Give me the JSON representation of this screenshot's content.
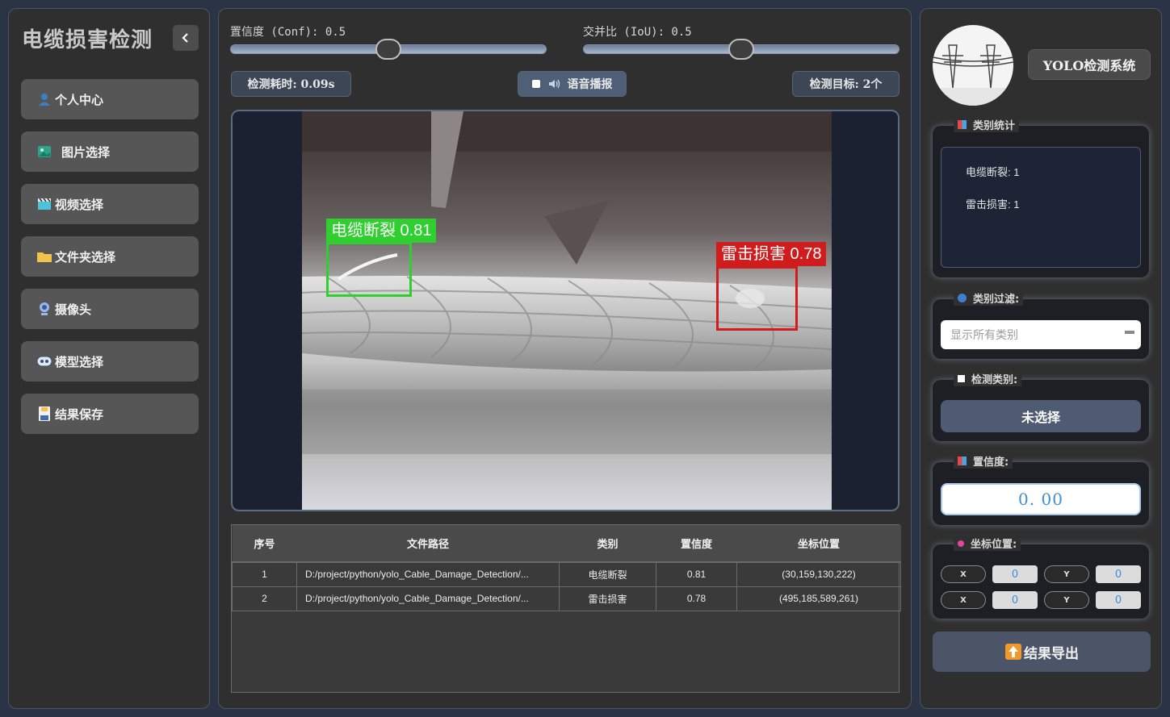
{
  "sidebar": {
    "title": "电缆损害检测",
    "items": [
      {
        "label": "个人中心",
        "icon": "user-icon"
      },
      {
        "label": "图片选择",
        "icon": "image-icon"
      },
      {
        "label": "视频选择",
        "icon": "video-icon"
      },
      {
        "label": "文件夹选择",
        "icon": "folder-icon"
      },
      {
        "label": "摄像头",
        "icon": "webcam-icon"
      },
      {
        "label": "模型选择",
        "icon": "model-icon"
      },
      {
        "label": "结果保存",
        "icon": "save-icon"
      }
    ]
  },
  "controls": {
    "conf_label": "置信度 (Conf): 0.5",
    "conf_value": 0.5,
    "iou_label": "交并比 (IoU): 0.5",
    "iou_value": 0.5,
    "time_label": "检测耗时: 0.09s",
    "voice_label": "语音播报",
    "targets_label": "检测目标: 2个"
  },
  "detections": [
    {
      "label": "电缆断裂 0.81",
      "color": "#2fcf2f"
    },
    {
      "label": "雷击损害 0.78",
      "color": "#d01c1c"
    }
  ],
  "close_glyph": "✕",
  "table": {
    "headers": [
      "序号",
      "文件路径",
      "类别",
      "置信度",
      "坐标位置"
    ],
    "rows": [
      [
        "1",
        "D:/project/python/yolo_Cable_Damage_Detection/...",
        "电缆断裂",
        "0.81",
        "(30,159,130,222)"
      ],
      [
        "2",
        "D:/project/python/yolo_Cable_Damage_Detection/...",
        "雷击损害",
        "0.78",
        "(495,185,589,261)"
      ]
    ]
  },
  "right": {
    "system_button": "YOLO检测系统",
    "stats_title": "类别统计",
    "stats": [
      "电缆断裂: 1",
      "雷击损害: 1"
    ],
    "filter_title": "类别过滤:",
    "filter_placeholder": "显示所有类别",
    "detected_class_title": "检测类别:",
    "detected_class_value": "未选择",
    "confidence_title": "置信度:",
    "confidence_value": "0. 00",
    "coords_title": "坐标位置:",
    "coords": [
      {
        "label": "X",
        "value": "0"
      },
      {
        "label": "Y",
        "value": "0"
      },
      {
        "label": "X",
        "value": "0"
      },
      {
        "label": "Y",
        "value": "0"
      }
    ],
    "export_button": "结果导出"
  },
  "colors": {
    "accent_blue": "#3f8fd8",
    "panel_bg": "#2f2f2f",
    "page_bg": "#2b3444"
  }
}
